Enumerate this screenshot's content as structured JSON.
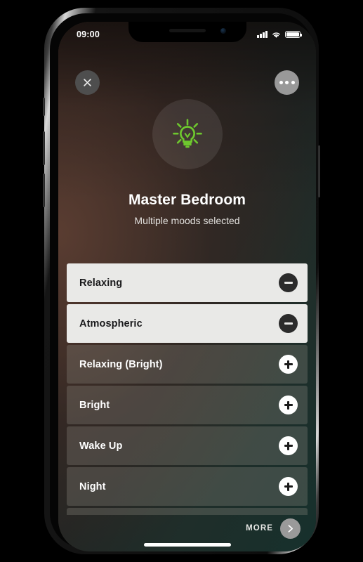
{
  "status_bar": {
    "time": "09:00",
    "signal_icon": "cellular-bars-icon",
    "wifi_icon": "wifi-icon",
    "battery_icon": "battery-full-icon"
  },
  "header": {
    "close_icon": "close-x-icon",
    "menu_icon": "more-dots-icon"
  },
  "hero": {
    "icon": "lightbulb-icon",
    "icon_color": "#6ec82e",
    "title": "Master Bedroom",
    "subtitle": "Multiple moods selected"
  },
  "moods": [
    {
      "label": "Relaxing",
      "selected": true,
      "action_icon": "minus-icon"
    },
    {
      "label": "Atmospheric",
      "selected": true,
      "action_icon": "minus-icon"
    },
    {
      "label": "Relaxing (Bright)",
      "selected": false,
      "action_icon": "plus-icon"
    },
    {
      "label": "Bright",
      "selected": false,
      "action_icon": "plus-icon"
    },
    {
      "label": "Wake Up",
      "selected": false,
      "action_icon": "plus-icon"
    },
    {
      "label": "Night",
      "selected": false,
      "action_icon": "plus-icon"
    }
  ],
  "footer": {
    "more_label": "MORE",
    "more_icon": "chevron-right-icon"
  },
  "colors": {
    "accent_green": "#6ec82e",
    "selected_row_bg": "#e9e9e7",
    "gradient_warm": "#3a2a24",
    "gradient_cool": "#16302c"
  }
}
